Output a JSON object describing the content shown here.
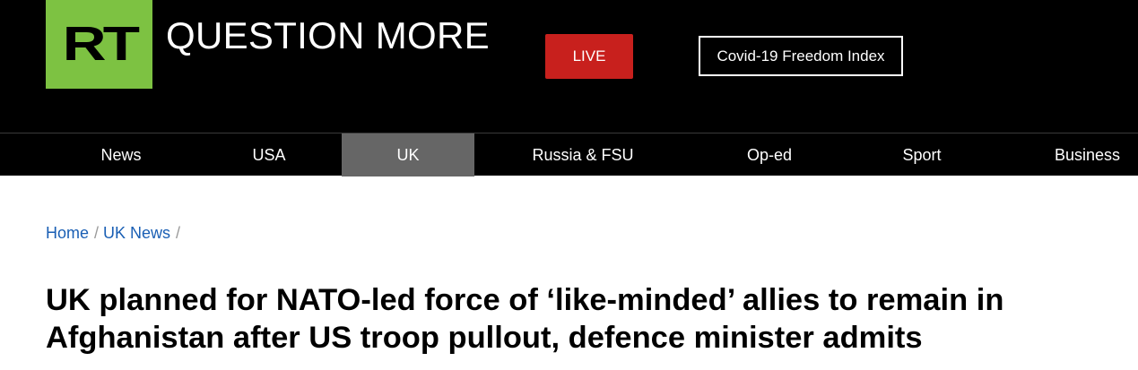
{
  "header": {
    "logo_text": "RT",
    "tagline": "QUESTION MORE",
    "live_label": "LIVE",
    "covid_label": "Covid-19 Freedom Index",
    "colors": {
      "logo_green": "#7dc242",
      "live_red": "#c8201d",
      "background": "#000000"
    }
  },
  "nav": {
    "items": [
      {
        "label": "News"
      },
      {
        "label": "USA"
      },
      {
        "label": "UK",
        "active": true
      },
      {
        "label": "Russia & FSU"
      },
      {
        "label": "Op-ed"
      },
      {
        "label": "Sport"
      },
      {
        "label": "Business"
      }
    ]
  },
  "breadcrumb": {
    "items": [
      "Home",
      "UK News"
    ],
    "separator": "/"
  },
  "article": {
    "headline": "UK planned for NATO-led force of ‘like-minded’ allies to remain in Afghanistan after US troop pullout, defence minister admits"
  }
}
